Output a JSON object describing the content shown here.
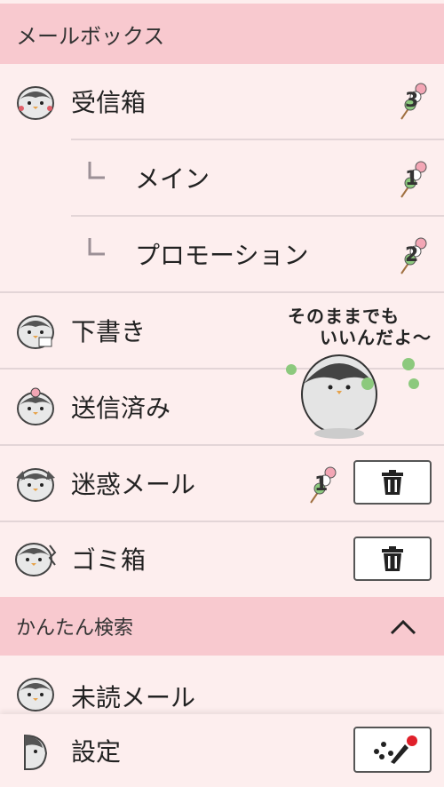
{
  "mailbox_header": {
    "title": "メールボックス"
  },
  "folders": {
    "inbox": {
      "label": "受信箱",
      "badge": "3"
    },
    "main": {
      "label": "メイン",
      "badge": "1"
    },
    "promotion": {
      "label": "プロモーション",
      "badge": "2"
    },
    "drafts": {
      "label": "下書き"
    },
    "sent": {
      "label": "送信済み"
    },
    "spam": {
      "label": "迷惑メール",
      "badge": "1"
    },
    "trash": {
      "label": "ゴミ箱"
    }
  },
  "sticker": {
    "line1": "そのままでも",
    "line2": "いいんだよ〜"
  },
  "quick_search": {
    "title": "かんたん検索",
    "items": {
      "unread": "未読メール"
    }
  },
  "footer": {
    "settings_label": "設定"
  },
  "colors": {
    "header_bg": "#f8c9cf",
    "row_bg": "#fdeeee",
    "accent_red": "#e0202a",
    "dango_pink": "#f3a6b5",
    "dango_green": "#8cc97d"
  },
  "icons": [
    "penguin-avatar-icon",
    "dango-badge-icon",
    "trash-icon",
    "paint-brush-icon",
    "chevron-up-icon"
  ]
}
